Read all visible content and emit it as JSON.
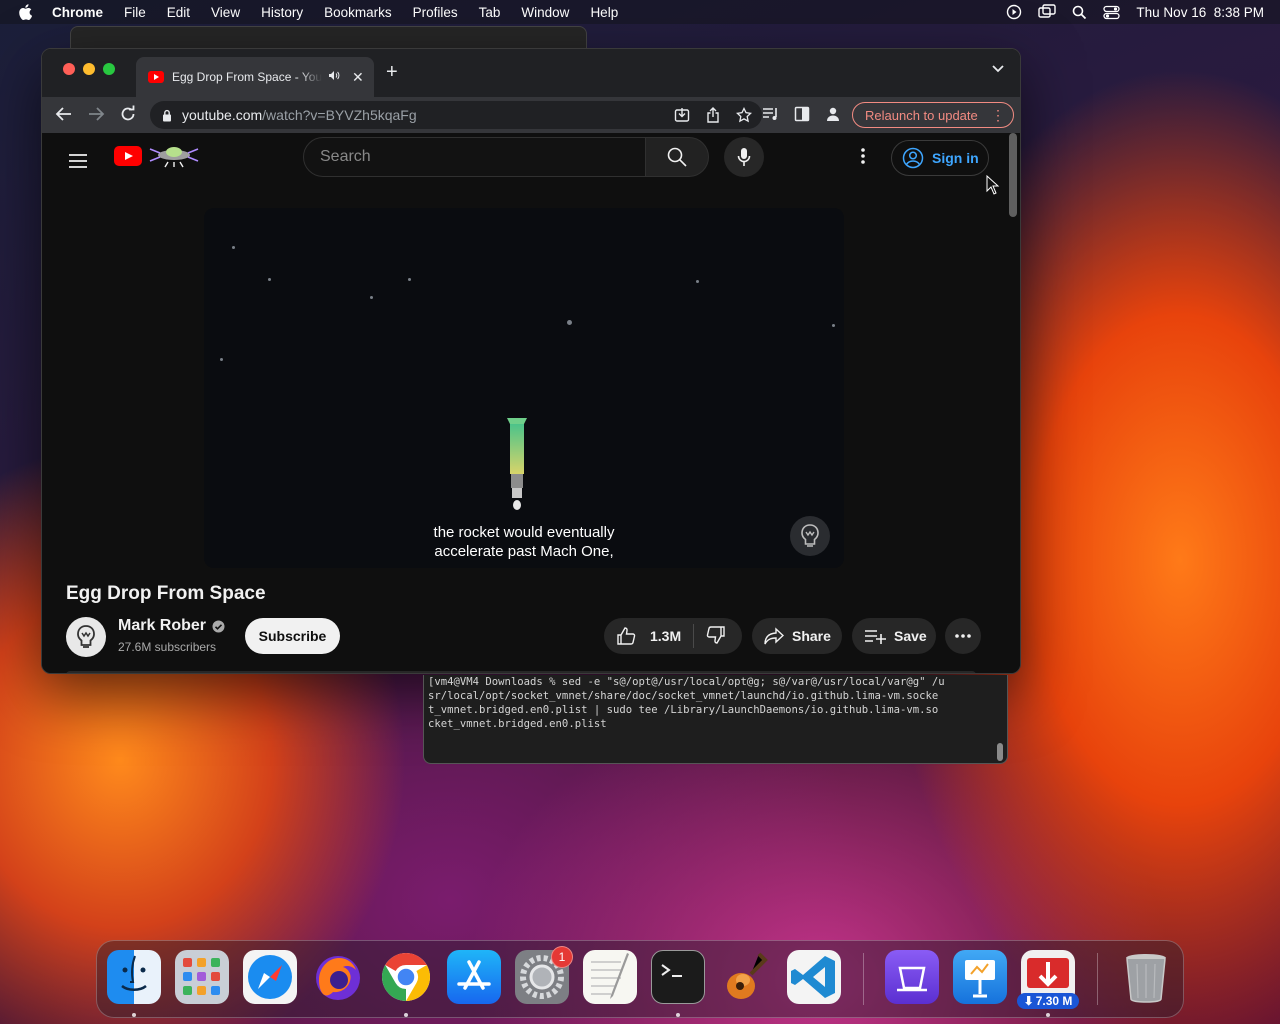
{
  "menubar": {
    "app": "Chrome",
    "items": [
      "File",
      "Edit",
      "View",
      "History",
      "Bookmarks",
      "Profiles",
      "Tab",
      "Window",
      "Help"
    ],
    "clock": "Thu Nov 16  8:38 PM"
  },
  "browser": {
    "tab_title": "Egg Drop From Space - YouTube",
    "url_host": "youtube.com",
    "url_path": "/watch?v=BYVZh5kqaFg",
    "relaunch_label": "Relaunch to update"
  },
  "youtube": {
    "search_placeholder": "Search",
    "sign_in": "Sign in",
    "caption_line1": "the rocket would eventually",
    "caption_line2": "accelerate past Mach One,",
    "video_title": "Egg Drop From Space",
    "channel_name": "Mark Rober",
    "subscribers": "27.6M subscribers",
    "subscribe_label": "Subscribe",
    "likes": "1.3M",
    "share_label": "Share",
    "save_label": "Save"
  },
  "terminal": {
    "lines": [
      "[vm4@VM4 Downloads % sed -e \"s@/opt@/usr/local/opt@g; s@/var@/usr/local/var@g\" /u",
      "sr/local/opt/socket_vmnet/share/doc/socket_vmnet/launchd/io.github.lima-vm.socke",
      "t_vmnet.bridged.en0.plist | sudo tee /Library/LaunchDaemons/io.github.lima-vm.so",
      "cket_vmnet.bridged.en0.plist"
    ]
  },
  "dock": {
    "apps": [
      "Finder",
      "Launchpad",
      "Safari",
      "Firefox",
      "Google Chrome",
      "App Store",
      "System Settings",
      "TextEdit",
      "Terminal",
      "GarageBand",
      "Visual Studio Code",
      "Apple Configurator",
      "Keynote",
      "Transmit",
      "Trash"
    ],
    "settings_badge": "1",
    "download_badge": "7.30 M"
  },
  "colors": {
    "youtube_red": "#ff0000",
    "link_blue": "#3ea6ff",
    "relaunch": "#f28b82"
  }
}
